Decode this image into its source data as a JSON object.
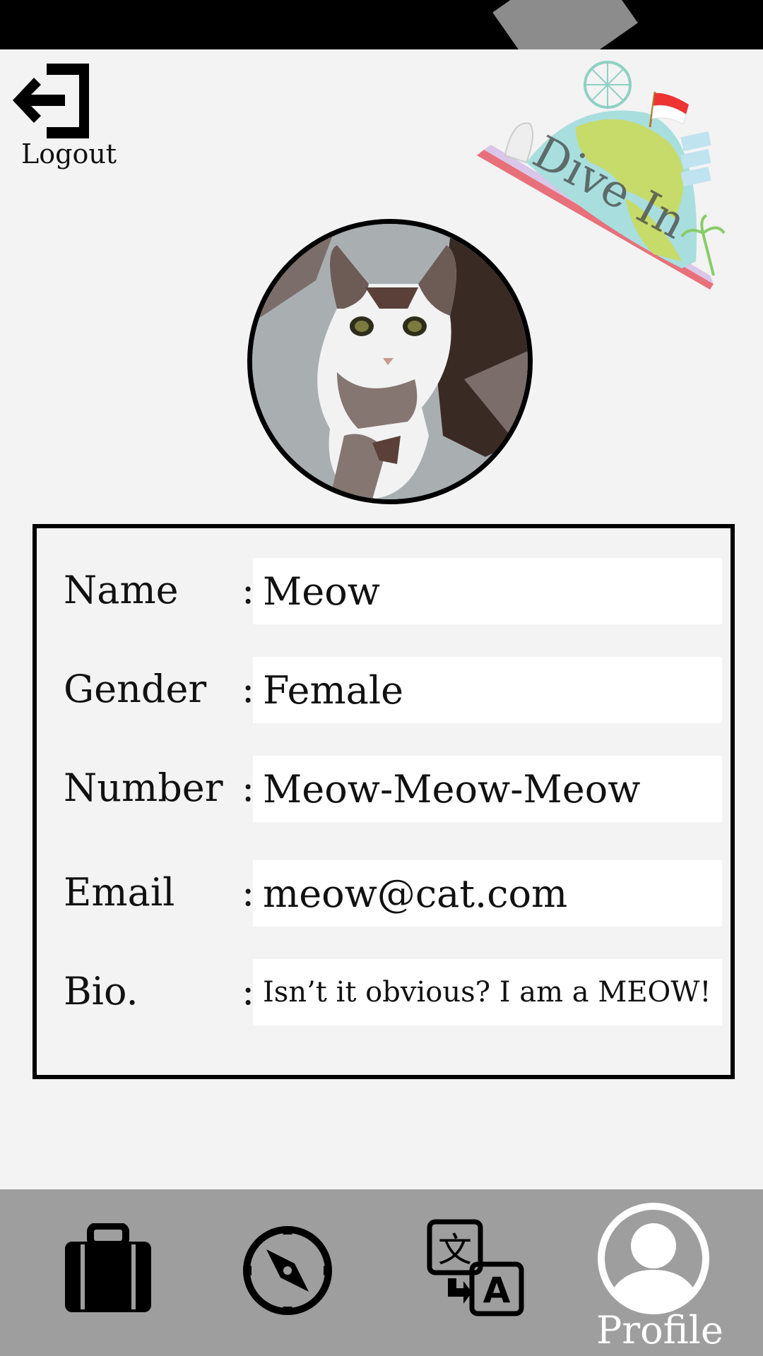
{
  "header": {
    "logout_label": "Logout",
    "logo_text": "Dive In"
  },
  "profile": {
    "fields": [
      {
        "label": "Name",
        "value": "Meow"
      },
      {
        "label": "Gender",
        "value": "Female"
      },
      {
        "label": "Number",
        "value": "Meow-Meow-Meow"
      },
      {
        "label": "Email",
        "value": "meow@cat.com"
      },
      {
        "label": "Bio.",
        "value": "Isn’t it obvious? I am a MEOW!"
      }
    ],
    "separator": ":"
  },
  "nav": {
    "items": [
      {
        "icon": "suitcase-icon",
        "label": ""
      },
      {
        "icon": "compass-icon",
        "label": ""
      },
      {
        "icon": "translate-icon",
        "label": ""
      },
      {
        "icon": "user-profile-icon",
        "label": "Profile"
      }
    ]
  },
  "colors": {
    "background": "#f3f3f3",
    "nav_background": "#9e9e9e",
    "status_bar": "#000000",
    "field_background": "#ffffff"
  }
}
